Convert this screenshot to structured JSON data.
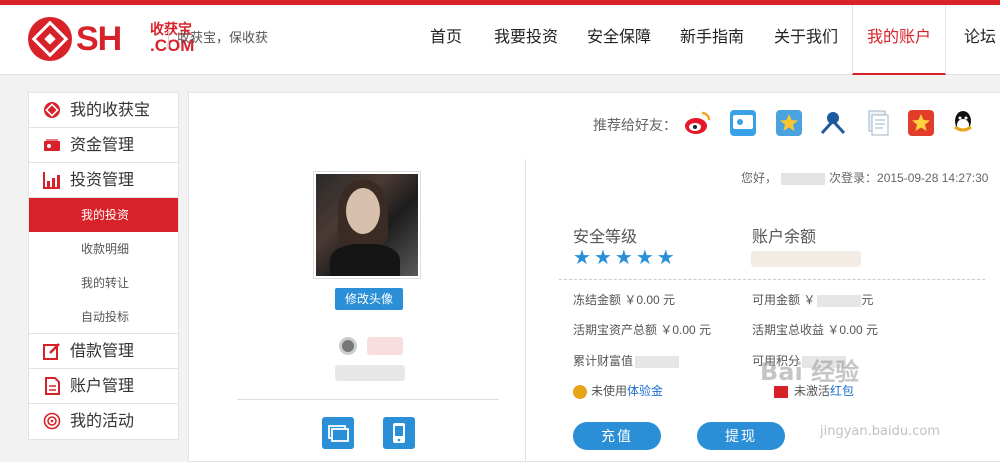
{
  "brand": {
    "logo_text": "SH",
    "logo_cn": "收获宝",
    "logo_com": ".COM",
    "slogan": "收获宝，保收获",
    "accent": "#d8222a",
    "blue": "#2a8fd6"
  },
  "nav": {
    "items": [
      "首页",
      "我要投资",
      "安全保障",
      "新手指南",
      "关于我们",
      "我的账户",
      "论坛"
    ],
    "active": "我的账户"
  },
  "sidebar": {
    "groups": [
      {
        "label": "我的收获宝",
        "icon": "shouhuobao-icon"
      },
      {
        "label": "资金管理",
        "icon": "wallet-icon"
      },
      {
        "label": "投资管理",
        "icon": "chart-icon"
      }
    ],
    "invest_sub": [
      "我的投资",
      "收款明细",
      "我的转让",
      "自动投标"
    ],
    "active_sub": "我的投资",
    "groups_after": [
      {
        "label": "借款管理",
        "icon": "edit-icon"
      },
      {
        "label": "账户管理",
        "icon": "document-icon"
      },
      {
        "label": "我的活动",
        "icon": "target-icon"
      }
    ]
  },
  "share": {
    "label": "推荐给好友：",
    "icons": [
      "weibo-icon",
      "qzone-icon",
      "favorite-star-icon",
      "renren-icon",
      "copy-doc-icon",
      "kaixin-icon",
      "qq-icon"
    ]
  },
  "profile": {
    "edit_avatar": "修改头像"
  },
  "account": {
    "greeting_prefix": "您好，",
    "last_login": "次登录：2015-09-28 14:27:30",
    "security_label": "安全等级",
    "security_stars": 5,
    "balance_label": "账户余额",
    "frozen": "冻结金额 ￥0.00 元",
    "available_prefix": "可用金额 ￥",
    "available_suffix": "元",
    "current_total": "活期宝资产总额 ￥0.00 元",
    "current_income": "活期宝总收益 ￥0.00 元",
    "wealth_label": "累计财富值",
    "points_label": "可用积分",
    "unused_prefix": "未使用",
    "trial_link": "体验金",
    "activate_text": "未激活",
    "red_link": "红包",
    "recharge": "充值",
    "withdraw": "提现"
  },
  "watermark": {
    "text": "Bai 经验",
    "url": "jingyan.baidu.com"
  }
}
